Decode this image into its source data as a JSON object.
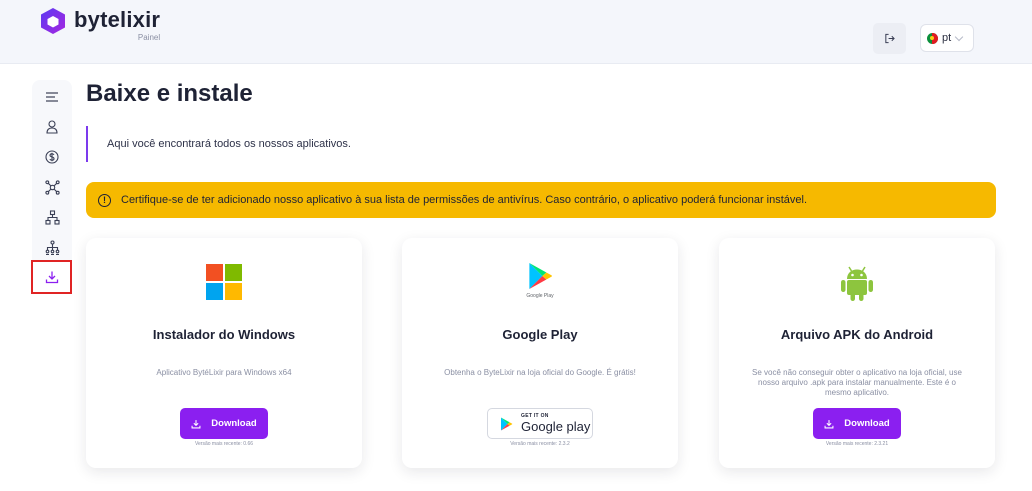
{
  "header": {
    "brand": "bytelixir",
    "subtitle": "Painel",
    "language": "pt",
    "icons": {
      "logout": "logout-icon",
      "flag": "portugal-flag-icon"
    }
  },
  "sidebar": {
    "items": [
      {
        "icon": "menu-icon"
      },
      {
        "icon": "user-icon"
      },
      {
        "icon": "dollar-icon"
      },
      {
        "icon": "network-icon"
      },
      {
        "icon": "sitemap-icon"
      },
      {
        "icon": "referral-tree-icon"
      },
      {
        "icon": "download-icon",
        "active": true
      }
    ]
  },
  "page": {
    "title": "Baixe e instale",
    "intro": "Aqui você encontrará todos os nossos aplicativos.",
    "alert": "Certifique-se de ter adicionado nosso aplicativo à sua lista de permissões de antivírus. Caso contrário, o aplicativo poderá funcionar instável.",
    "alert_icon_glyph": "!"
  },
  "cards": [
    {
      "title": "Instalador do Windows",
      "description": "Aplicativo BytéLixir para Windows x64",
      "button": "Download",
      "version": "Versão mais recente: 0.66",
      "icon": "windows-logo-icon"
    },
    {
      "title": "Google Play",
      "description": "Obtenha o ByteLixir na loja oficial do Google. É grátis!",
      "icon_caption": "Google Play",
      "badge_small": "GET IT ON",
      "badge_big": "Google play",
      "version": "Versão mais recente: 2.3.2",
      "icon": "google-play-icon"
    },
    {
      "title": "Arquivo APK do Android",
      "description": "Se você não conseguir obter o aplicativo na loja oficial, use nosso arquivo .apk para instalar manualmente. Este é o mesmo aplicativo.",
      "button": "Download",
      "version": "Versão mais recente: 2.3.21",
      "icon": "android-icon"
    }
  ],
  "colors": {
    "accent": "#8b1ff0",
    "alert": "#f6b900",
    "highlight_border": "#e02424"
  }
}
